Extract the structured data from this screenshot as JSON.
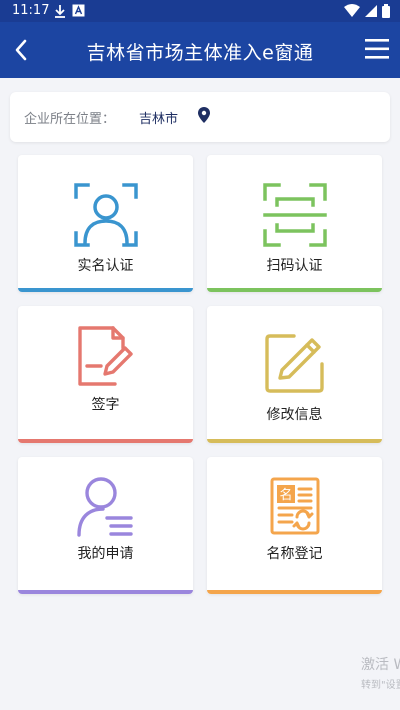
{
  "status_bar": {
    "time": "11:17",
    "icons": [
      "download-icon",
      "a-box-icon",
      "wifi-icon",
      "signal-icon",
      "battery-icon"
    ]
  },
  "app_bar": {
    "title": "吉林省市场主体准入e窗通",
    "left_icon": "back-chevron-icon",
    "right_icon": "menu-icon"
  },
  "location": {
    "label": "企业所在位置：",
    "city": "吉林市",
    "icon": "location-pin-icon"
  },
  "cards": [
    {
      "label": "实名认证",
      "icon": "face-scan-icon",
      "color": "#3a95cf"
    },
    {
      "label": "扫码认证",
      "icon": "qr-scan-icon",
      "color": "#7cc35e"
    },
    {
      "label": "签字",
      "icon": "signature-document-icon",
      "color": "#e5786f"
    },
    {
      "label": "修改信息",
      "icon": "edit-pencil-icon",
      "color": "#d6bc5a"
    },
    {
      "label": "我的申请",
      "icon": "user-list-icon",
      "color": "#9a86dd"
    },
    {
      "label": "名称登记",
      "icon": "name-register-icon",
      "color": "#f4a54c"
    }
  ],
  "watermark": {
    "line1": "激活 W",
    "line2": "转到\"设置"
  }
}
